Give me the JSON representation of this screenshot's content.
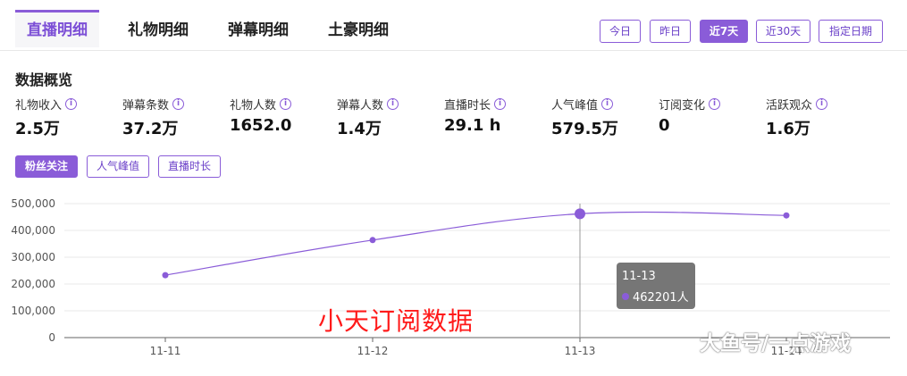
{
  "tabs": [
    {
      "label": "直播明细",
      "active": true
    },
    {
      "label": "礼物明细",
      "active": false
    },
    {
      "label": "弹幕明细",
      "active": false
    },
    {
      "label": "土豪明细",
      "active": false
    }
  ],
  "period_buttons": [
    {
      "label": "今日",
      "active": false
    },
    {
      "label": "昨日",
      "active": false
    },
    {
      "label": "近7天",
      "active": true
    },
    {
      "label": "近30天",
      "active": false
    },
    {
      "label": "指定日期",
      "active": false
    }
  ],
  "overview": {
    "title": "数据概览",
    "stats": [
      {
        "label": "礼物收入",
        "value": "2.5万"
      },
      {
        "label": "弹幕条数",
        "value": "37.2万"
      },
      {
        "label": "礼物人数",
        "value": "1652.0"
      },
      {
        "label": "弹幕人数",
        "value": "1.4万"
      },
      {
        "label": "直播时长",
        "value": "29.1 h"
      },
      {
        "label": "人气峰值",
        "value": "579.5万"
      },
      {
        "label": "订阅变化",
        "value": "0"
      },
      {
        "label": "活跃观众",
        "value": "1.6万"
      }
    ]
  },
  "metric_buttons": [
    {
      "label": "粉丝关注",
      "active": true
    },
    {
      "label": "人气峰值",
      "active": false
    },
    {
      "label": "直播时长",
      "active": false
    }
  ],
  "chart_data": {
    "type": "line",
    "categories": [
      "11-11",
      "11-12",
      "11-13",
      "11-14"
    ],
    "values": [
      233000,
      364000,
      462201,
      456000
    ],
    "ylim": [
      0,
      500000
    ],
    "yticks": [
      "0",
      "100,000",
      "200,000",
      "300,000",
      "400,000",
      "500,000"
    ],
    "grid": true,
    "line_color": "#8a5cd8",
    "tooltip": {
      "date": "11-13",
      "value_text": "462201人"
    }
  },
  "overlay_text": "小天订阅数据",
  "watermark": "大鱼号/一点游戏",
  "colors": {
    "accent": "#8a5cd8",
    "overlay": "#ff1a1a"
  }
}
